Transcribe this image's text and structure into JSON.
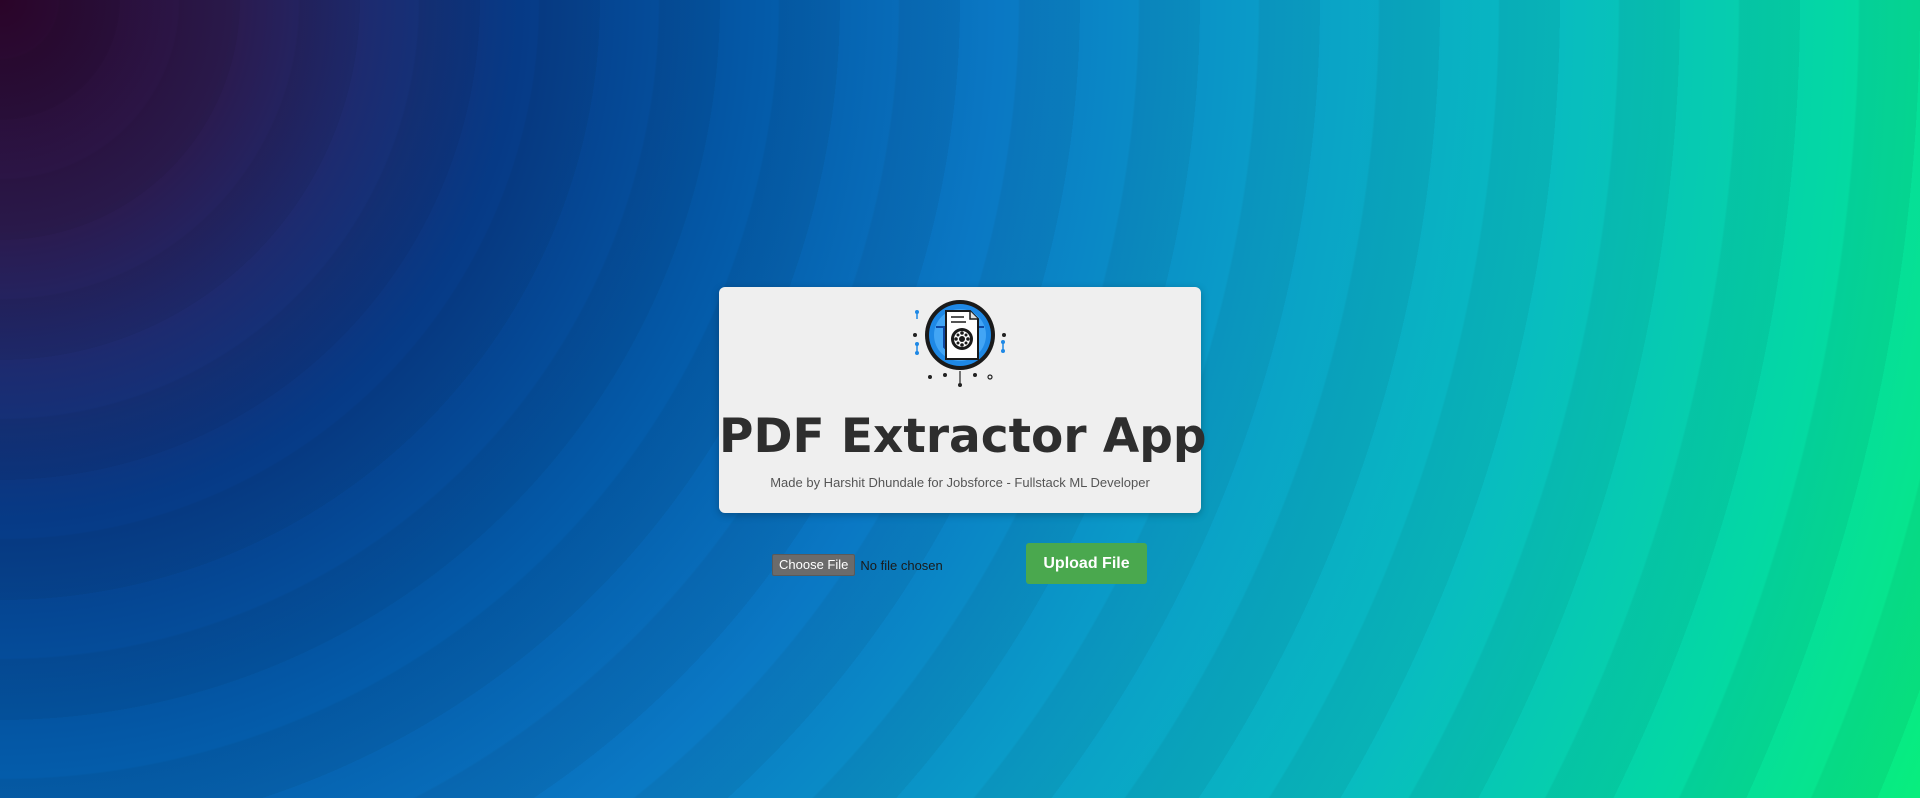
{
  "header": {
    "logo_icon": "pdf-extractor-logo-icon",
    "title": "PDF Extractor App",
    "subtitle": "Made by Harshit Dhundale for Jobsforce - Fullstack ML Developer"
  },
  "upload": {
    "choose_label": "Choose File",
    "file_status": "No file chosen",
    "upload_label": "Upload File"
  },
  "colors": {
    "card_bg": "#efefef",
    "upload_button": "#4aa84e",
    "choose_button": "#6b6b6b",
    "logo_blue": "#1e88e5"
  }
}
